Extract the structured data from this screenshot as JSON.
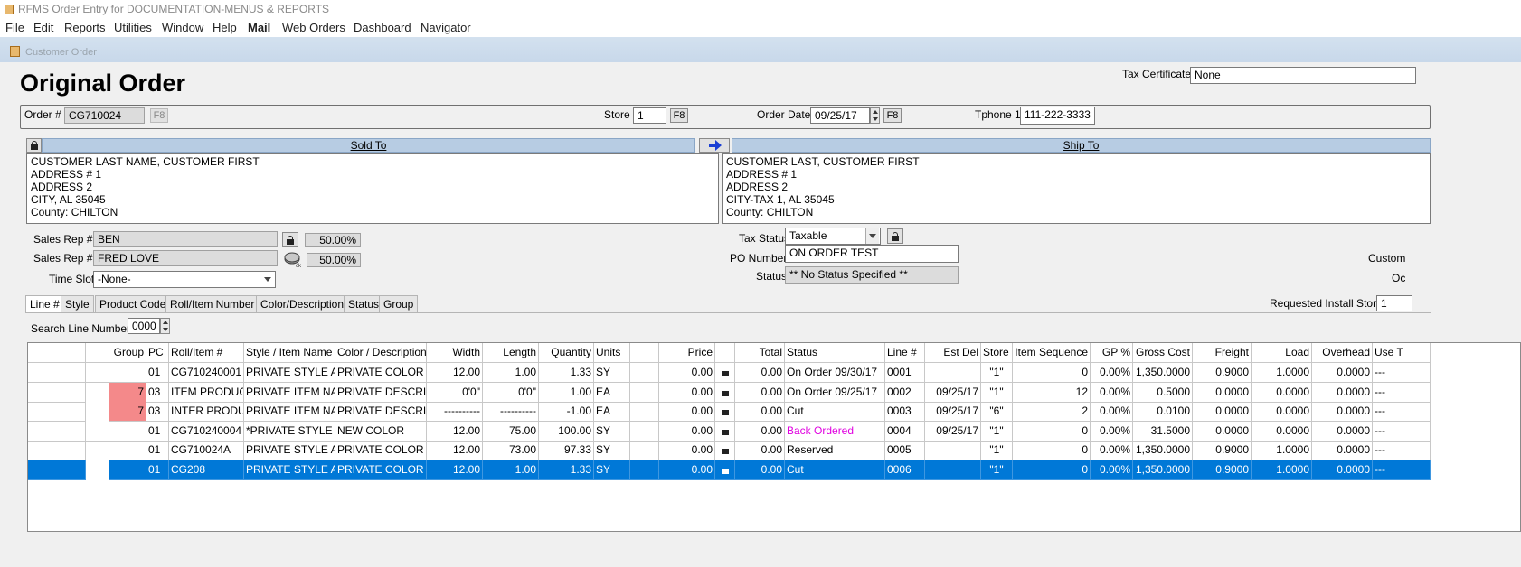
{
  "window": {
    "title": "RFMS Order Entry for DOCUMENTATION-MENUS & REPORTS"
  },
  "menu": [
    "File",
    "Edit",
    "Reports",
    "Utilities",
    "Window",
    "Help",
    "Mail",
    "Web Orders",
    "Dashboard",
    "Navigator"
  ],
  "doc_tab": "Customer Order",
  "heading": "Original Order",
  "tax_certificate": {
    "label": "Tax Certificate",
    "value": "None"
  },
  "order": {
    "order_label": "Order #",
    "order_value": "CG710024",
    "f8": "F8",
    "store_label": "Store",
    "store_value": "1",
    "date_label": "Order Date",
    "date_value": "09/25/17",
    "phone_label": "Tphone 1",
    "phone_value": "111-222-3333"
  },
  "sold_to": {
    "header": "Sold To",
    "lines": [
      "CUSTOMER LAST NAME, CUSTOMER FIRST",
      "ADDRESS # 1",
      "ADDRESS 2",
      "CITY, AL  35045",
      "County: CHILTON"
    ]
  },
  "ship_to": {
    "header": "Ship To",
    "lines": [
      "CUSTOMER LAST, CUSTOMER FIRST",
      "ADDRESS # 1",
      "ADDRESS 2",
      "CITY-TAX 1, AL  35045",
      "County: CHILTON"
    ]
  },
  "reps": {
    "rep1_label": "Sales Rep #1",
    "rep1_value": "BEN",
    "rep1_pct": "50.00%",
    "rep2_label": "Sales Rep #2",
    "rep2_value": "FRED LOVE",
    "rep2_pct": "50.00%",
    "timeslot_label": "Time Slot",
    "timeslot_value": "-None-"
  },
  "right_fields": {
    "tax_status_label": "Tax Status",
    "tax_status_value": "Taxable",
    "po_label": "PO Number",
    "po_value": "ON ORDER TEST",
    "status_label": "Status",
    "status_value": "** No Status Specified **",
    "cut_text_1": "Custom",
    "cut_text_2": "Oc"
  },
  "tabs": [
    "Line #",
    "Style",
    "Product Code",
    "Roll/Item Number",
    "Color/Description",
    "Status",
    "Group"
  ],
  "requested_install": {
    "label": "Requested Install Store",
    "value": "1"
  },
  "search_line": {
    "label": "Search Line Number",
    "value": "0000"
  },
  "grid": {
    "headers": [
      "",
      "Group",
      "PC",
      "Roll/Item #",
      "Style / Item Name",
      "Color / Description",
      "Width",
      "Length",
      "Quantity",
      "Units",
      "",
      "Price",
      "",
      "Total",
      "Status",
      "Line #",
      "Est Del",
      "Store",
      "Item Sequence",
      "GP %",
      "Gross Cost",
      "Freight",
      "Load",
      "Overhead",
      "Use T"
    ],
    "rows": [
      [
        "",
        "",
        "01",
        "CG710240001",
        "PRIVATE  STYLE A",
        "PRIVATE  COLOR",
        "12.00",
        "1.00",
        "1.33",
        "SY",
        "",
        "0.00",
        "",
        "0.00",
        "On Order 09/30/17",
        "0001",
        "",
        "\"1\"",
        "0",
        "0.00%",
        "1,350.0000",
        "0.9000",
        "1.0000",
        "0.0000",
        "---"
      ],
      [
        "",
        "7",
        "03",
        "ITEM PRODUCT",
        "PRIVATE  ITEM NAM",
        "PRIVATE DESCRIPTIO",
        "0'0\"",
        "0'0\"",
        "1.00",
        "EA",
        "",
        "0.00",
        "",
        "0.00",
        "On Order 09/25/17",
        "0002",
        "09/25/17",
        "\"1\"",
        "12",
        "0.00%",
        "0.5000",
        "0.0000",
        "0.0000",
        "0.0000",
        "---"
      ],
      [
        "",
        "7",
        "03",
        "INTER PRODUCT",
        "PRIVATE  ITEM NAM",
        "PRIVATE DESCRIPTIO",
        "----------",
        "----------",
        "-1.00",
        "EA",
        "",
        "0.00",
        "",
        "0.00",
        "Cut",
        "0003",
        "09/25/17",
        "\"6\"",
        "2",
        "0.00%",
        "0.0100",
        "0.0000",
        "0.0000",
        "0.0000",
        "---"
      ],
      [
        "",
        "",
        "01",
        "CG710240004",
        "*PRIVATE STYLE",
        "NEW COLOR",
        "12.00",
        "75.00",
        "100.00",
        "SY",
        "",
        "0.00",
        "",
        "0.00",
        "Back Ordered",
        "0004",
        "09/25/17",
        "\"1\"",
        "0",
        "0.00%",
        "31.5000",
        "0.0000",
        "0.0000",
        "0.0000",
        "---"
      ],
      [
        "",
        "",
        "01",
        "CG710024A",
        "PRIVATE  STYLE A",
        "PRIVATE  COLOR",
        "12.00",
        "73.00",
        "97.33",
        "SY",
        "",
        "0.00",
        "",
        "0.00",
        "Reserved",
        "0005",
        "",
        "\"1\"",
        "0",
        "0.00%",
        "1,350.0000",
        "0.9000",
        "1.0000",
        "0.0000",
        "---"
      ],
      [
        "",
        "",
        "01",
        "CG208",
        "PRIVATE  STYLE A",
        "PRIVATE  COLOR",
        "12.00",
        "1.00",
        "1.33",
        "SY",
        "",
        "0.00",
        "",
        "0.00",
        "Cut",
        "0006",
        "",
        "\"1\"",
        "0",
        "0.00%",
        "1,350.0000",
        "0.9000",
        "1.0000",
        "0.0000",
        "---"
      ]
    ],
    "selected_row": 5,
    "pink_rows": [
      1,
      2
    ],
    "magenta_status_row": 3
  },
  "colors": {
    "selection": "#0078d7",
    "header_band": "#b7cce3",
    "group_flag": "#f4898a",
    "back_ordered": "#e000e0"
  }
}
